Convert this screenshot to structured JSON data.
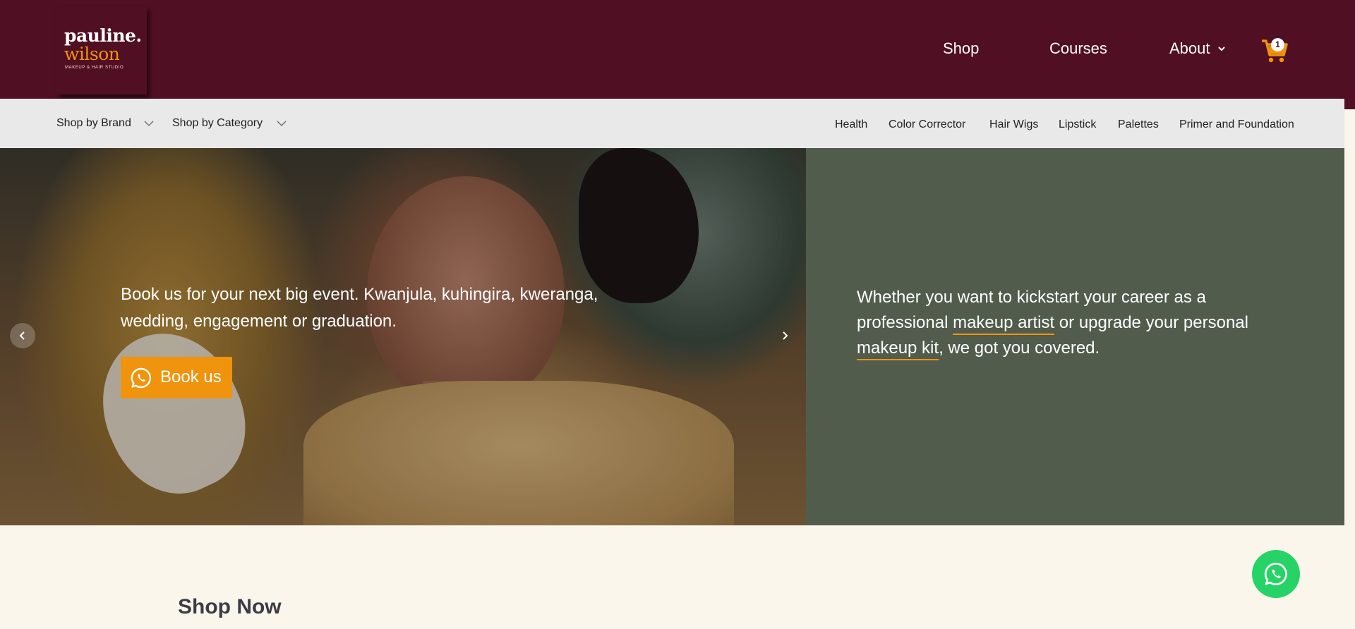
{
  "brand": {
    "line1": "pauline.",
    "line2": "wilson",
    "tagline": "MAKEUP & HAIR STUDIO"
  },
  "nav": {
    "shop": "Shop",
    "courses": "Courses",
    "about": "About",
    "cart_count": "1"
  },
  "subnav": {
    "shop_by_brand": "Shop by Brand",
    "shop_by_category": "Shop by Category",
    "links": [
      "Health",
      "Color Corrector",
      "Hair Wigs",
      "Lipstick",
      "Palettes",
      "Primer and Foundation"
    ]
  },
  "hero": {
    "slide_text": "Book us for your next big event. Kwanjula, kuhingira, kweranga, wedding, engagement or graduation.",
    "book_button": "Book us",
    "tagline_parts": {
      "a": "Whether you want to kickstart your career as a professional ",
      "link1": "makeup artist",
      "b": " or upgrade your personal ",
      "link2": "makeup kit",
      "c": ", we got you covered."
    }
  },
  "section": {
    "shop_now": "Shop Now"
  },
  "colors": {
    "header_bg": "#510f24",
    "accent": "#f0930d",
    "hero_right_bg": "#525c4d",
    "whatsapp": "#25d366"
  },
  "icons": {
    "cart": "cart-icon",
    "whatsapp": "whatsapp-icon",
    "chevron": "chevron-down-icon",
    "arrow_left": "chevron-left-icon",
    "arrow_right": "chevron-right-icon"
  }
}
